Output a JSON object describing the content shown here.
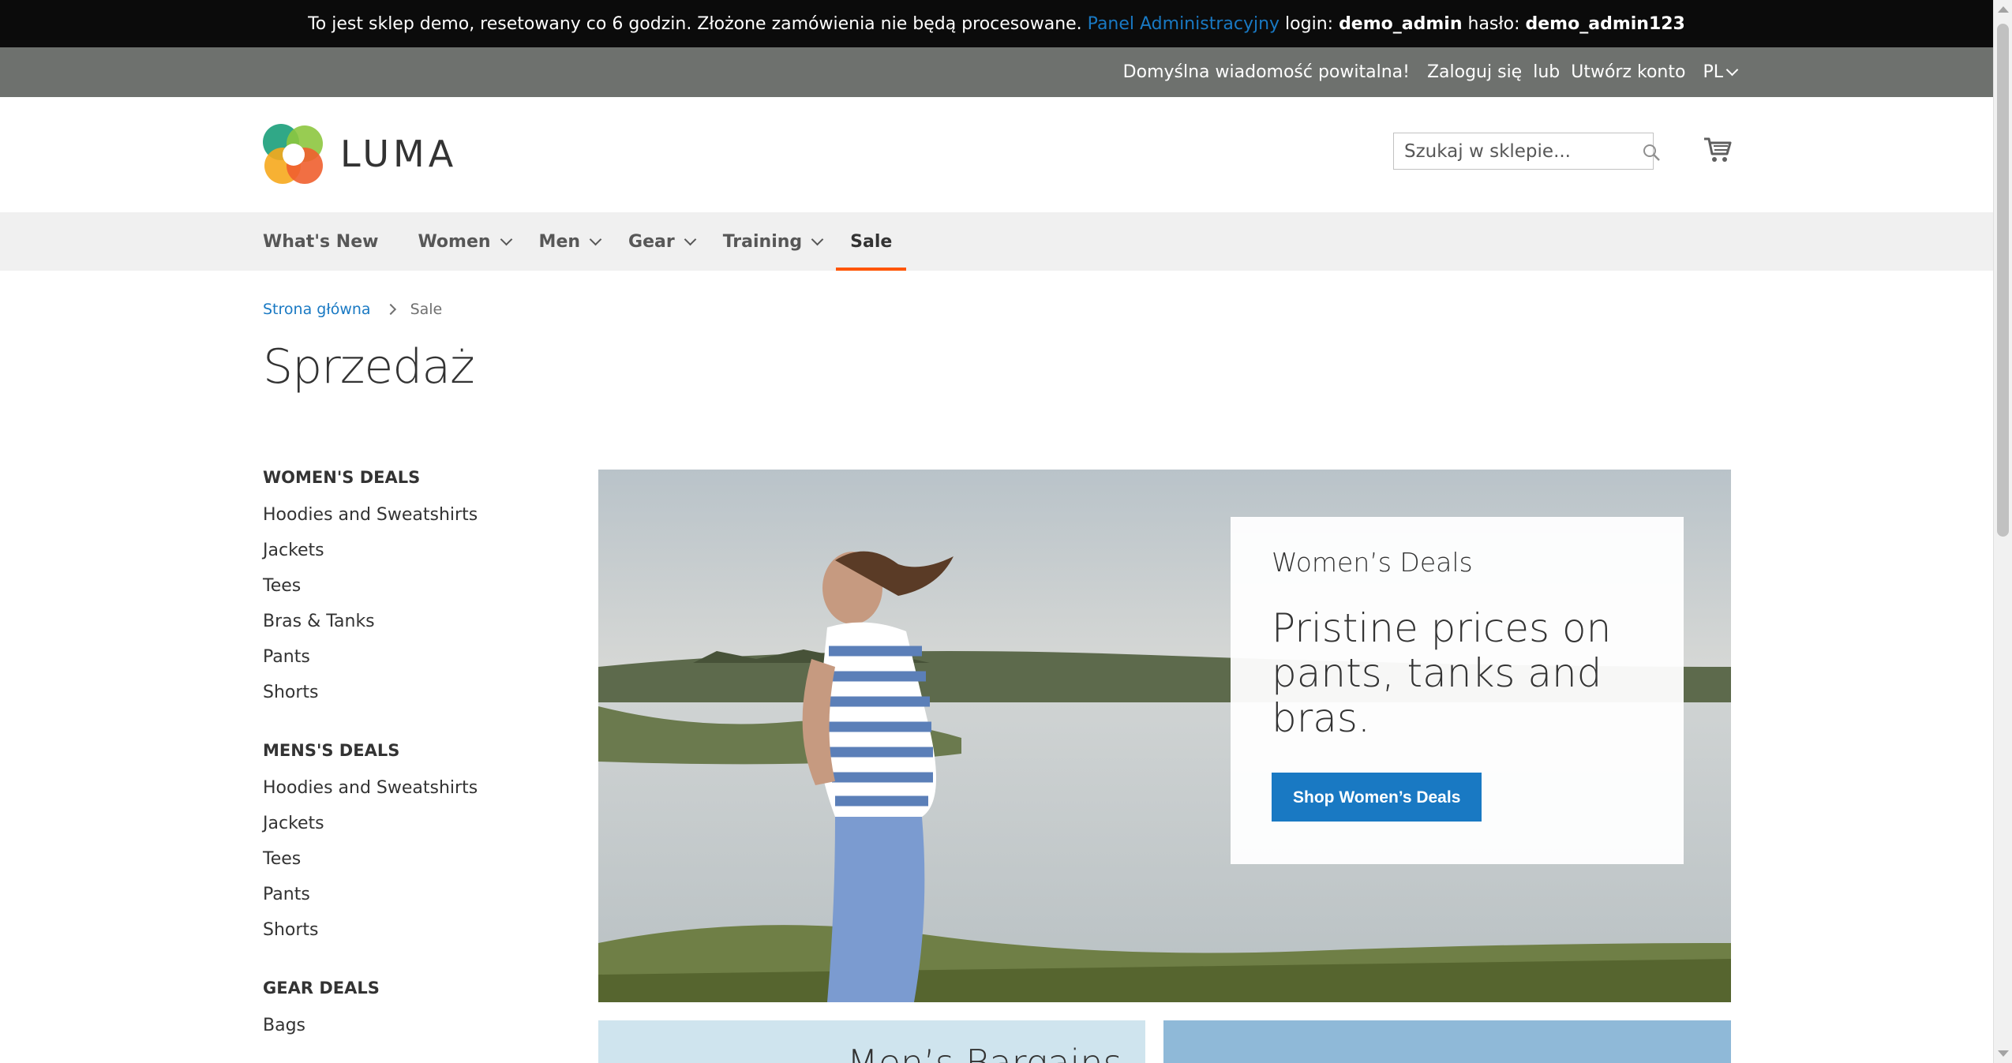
{
  "demo_notice": {
    "text": "To jest sklep demo, resetowany co 6 godzin. Złożone zamówienia nie będą procesowane.",
    "admin_link": "Panel Administracyjny",
    "login_label": "login:",
    "login_value": "demo_admin",
    "password_label": "hasło:",
    "password_value": "demo_admin123"
  },
  "header_links": {
    "welcome": "Domyślna wiadomość powitalna!",
    "sign_in": "Zaloguj się",
    "or": "lub",
    "create_account": "Utwórz konto",
    "language": "PL"
  },
  "logo": {
    "text": "LUMA",
    "icon": "luma-logo-icon"
  },
  "search": {
    "placeholder": "Szukaj w sklepie...",
    "icon": "search-icon"
  },
  "cart": {
    "icon": "cart-icon"
  },
  "nav": {
    "items": [
      {
        "label": "What's New"
      },
      {
        "label": "Women"
      },
      {
        "label": "Men"
      },
      {
        "label": "Gear"
      },
      {
        "label": "Training"
      },
      {
        "label": "Sale"
      }
    ],
    "active": "Sale"
  },
  "breadcrumbs": {
    "home": "Strona główna",
    "current": "Sale"
  },
  "page_title": "Sprzedaż",
  "sidebar": {
    "groups": [
      {
        "title": "WOMEN'S DEALS",
        "items": [
          "Hoodies and Sweatshirts",
          "Jackets",
          "Tees",
          "Bras & Tanks",
          "Pants",
          "Shorts"
        ]
      },
      {
        "title": "MENS'S DEALS",
        "items": [
          "Hoodies and Sweatshirts",
          "Jackets",
          "Tees",
          "Pants",
          "Shorts"
        ]
      },
      {
        "title": "GEAR DEALS",
        "items": [
          "Bags"
        ]
      }
    ]
  },
  "hero": {
    "kicker": "Women’s Deals",
    "headline": "Pristine prices on pants, tanks and bras.",
    "cta": "Shop Women’s Deals"
  },
  "tiles": {
    "men_label": "Men’s Bargains"
  },
  "colors": {
    "accent": "#1979c3",
    "sale_underline": "#ff5501",
    "top_bar": "#0b0b0b",
    "header_bar": "#6e716e",
    "nav_bg": "#f0f0f0"
  }
}
